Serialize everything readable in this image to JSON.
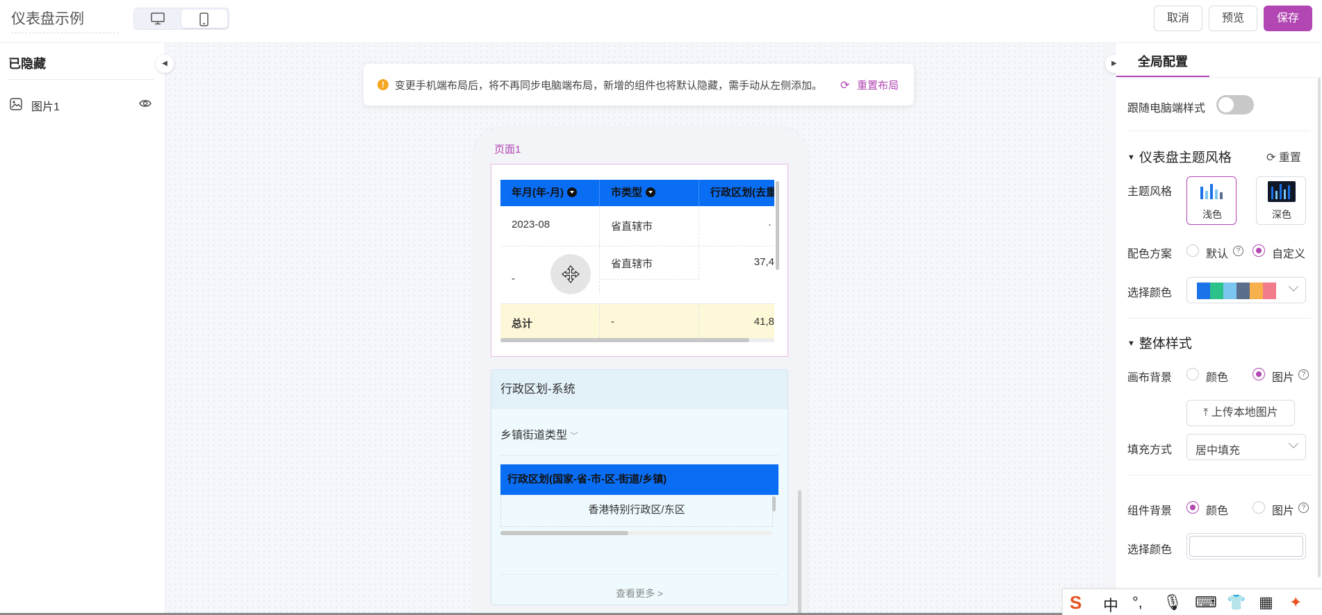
{
  "header": {
    "title": "仪表盘示例",
    "cancel": "取消",
    "preview": "预览",
    "save": "保存"
  },
  "left_panel": {
    "title": "已隐藏",
    "items": [
      {
        "label": "图片1"
      }
    ]
  },
  "notice": {
    "message": "变更手机端布局后，将不再同步电脑端布局，新增的组件也将默认隐藏，需手动从左侧添加。",
    "link": "重置布局"
  },
  "phone": {
    "page_label": "页面1",
    "table1": {
      "headers": [
        "年月(年-月)",
        "市类型",
        "行政区划(去重"
      ],
      "rows": [
        [
          "2023-08",
          "省直辖市",
          ""
        ],
        [
          "-",
          "省直辖市",
          "37,4"
        ]
      ],
      "total": [
        "总计",
        "-",
        "41,8"
      ]
    },
    "widget2": {
      "title": "行政区划-系统",
      "filter": "乡镇街道类型",
      "table_header": "行政区划(国家-省-市-区-街道/乡镇)",
      "table_row": "香港特别行政区/东区",
      "more": "查看更多"
    }
  },
  "right_panel": {
    "tab": "全局配置",
    "follow_label": "跟随电脑端样式",
    "theme_section": "仪表盘主题风格",
    "reset": "重置",
    "theme_label": "主题风格",
    "theme_light": "浅色",
    "theme_dark": "深色",
    "palette_label": "配色方案",
    "palette_default": "默认",
    "palette_custom": "自定义",
    "choose_color": "选择颜色",
    "overall_section": "整体样式",
    "canvas_bg": "画布背景",
    "opt_color": "颜色",
    "opt_image": "图片",
    "upload": "上传本地图片",
    "fill_label": "填充方式",
    "fill_value": "居中填充",
    "widget_bg": "组件背景",
    "choose_color2": "选择颜色",
    "palette_colors": [
      "#1a73e8",
      "#2ec28b",
      "#7bc6f0",
      "#5b6f8c",
      "#f7b04c",
      "#f27b8c"
    ]
  },
  "ime": {
    "zh": "中",
    "punct": "°,"
  },
  "colors": {
    "accent": "#b246b2",
    "table_header": "#0a6ef5"
  }
}
